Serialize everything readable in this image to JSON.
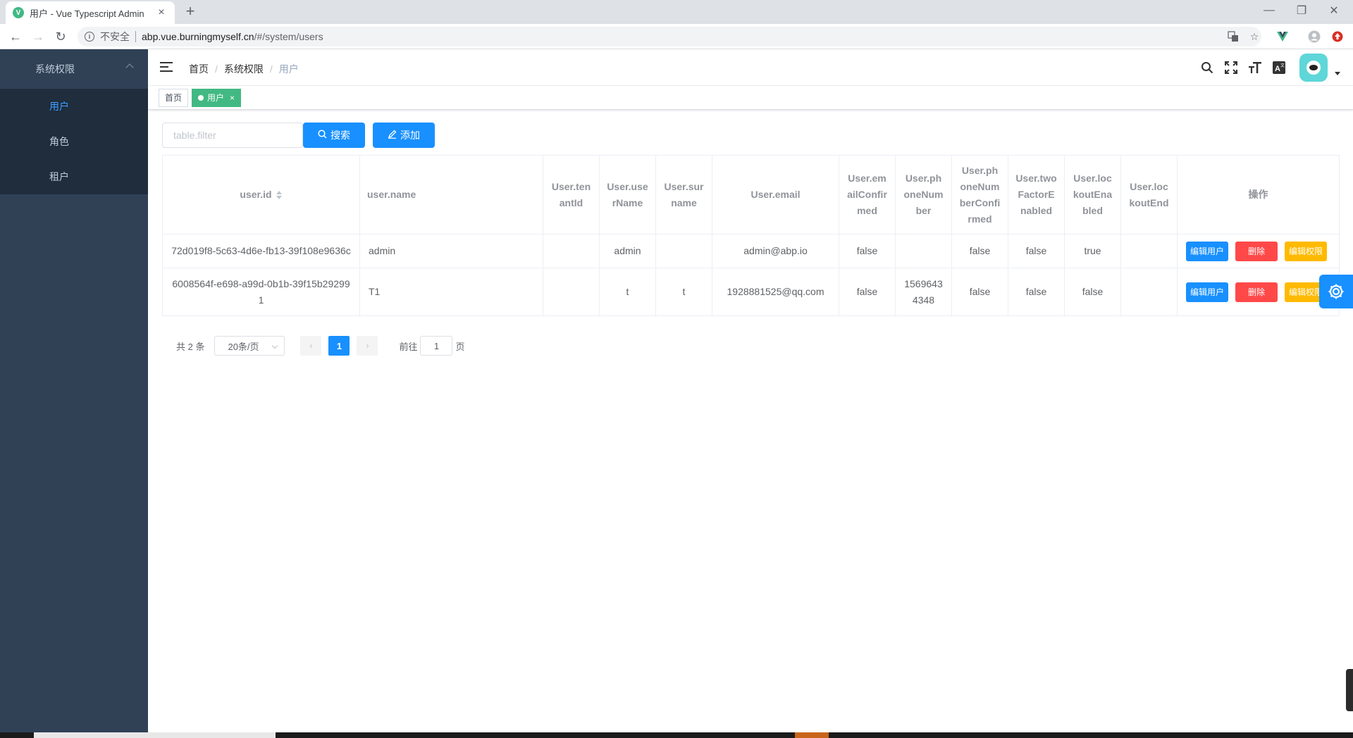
{
  "browser": {
    "tab_title": "用户 - Vue Typescript Admin",
    "tab_close": "×",
    "new_tab": "+",
    "favicon_letter": "V",
    "security_label": "不安全",
    "url_host": "abp.vue.burningmyself.cn",
    "url_path": "/#/system/users",
    "win_minimize": "—",
    "win_restore": "❐",
    "win_close": "✕"
  },
  "sidebar": {
    "group": "系统权限",
    "items": [
      {
        "label": "用户",
        "active": true
      },
      {
        "label": "角色",
        "active": false
      },
      {
        "label": "租户",
        "active": false
      }
    ]
  },
  "breadcrumb": [
    "首页",
    "系统权限",
    "用户"
  ],
  "breadcrumb_sep": "/",
  "tags": [
    {
      "label": "首页",
      "active": false
    },
    {
      "label": "用户",
      "active": true
    }
  ],
  "tag_close": "×",
  "filter": {
    "placeholder": "table.filter",
    "search_label": "搜索",
    "add_label": "添加"
  },
  "table": {
    "headers": [
      "user.id",
      "user.name",
      "User.tenantId",
      "User.userName",
      "User.surname",
      "User.email",
      "User.emailConfirmed",
      "User.phoneNumber",
      "User.phoneNumberConfirmed",
      "User.twoFactorEnabled",
      "User.lockoutEnabled",
      "User.lockoutEnd",
      "操作"
    ],
    "rows": [
      [
        "72d019f8-5c63-4d6e-fb13-39f108e9636c",
        "admin",
        "",
        "admin",
        "",
        "admin@abp.io",
        "false",
        "",
        "false",
        "false",
        "true",
        ""
      ],
      [
        "6008564f-e698-a99d-0b1b-39f15b292991",
        "T1",
        "",
        "t",
        "t",
        "1928881525@qq.com",
        "false",
        "15696434348",
        "false",
        "false",
        "false",
        ""
      ]
    ],
    "actions": [
      "编辑用户",
      "删除",
      "编辑权限"
    ]
  },
  "pager": {
    "total": "共 2 条",
    "page_size": "20条/页",
    "current": "1",
    "goto_prefix": "前往",
    "goto_value": "1",
    "goto_suffix": "页",
    "prev": "‹",
    "next": "›"
  },
  "colors": {
    "sidebar_bg": "#304156",
    "submenu_bg": "#1f2d3d",
    "primary": "#1890ff",
    "danger": "#ff4949",
    "warning": "#ffba00",
    "tag_active": "#42b983"
  }
}
